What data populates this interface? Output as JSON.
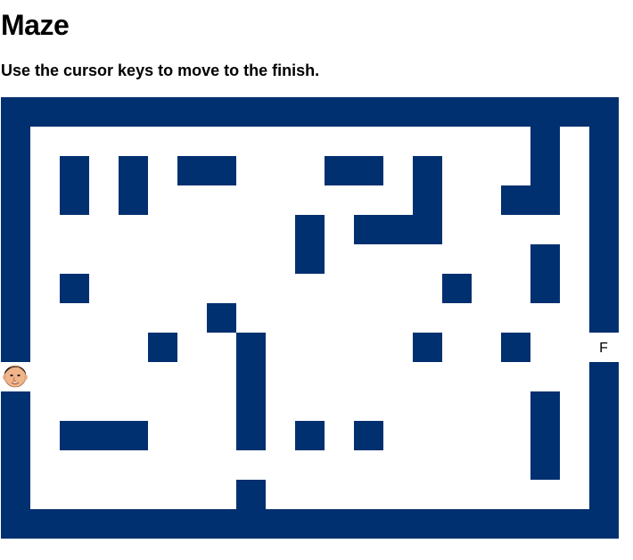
{
  "page": {
    "title": "Maze",
    "instructions": "Use the cursor keys to move to the finish."
  },
  "maze": {
    "wall_color": "#00306f",
    "path_color": "#ffffff",
    "finish_label": "F",
    "player_icon": "face-avatar-icon"
  }
}
